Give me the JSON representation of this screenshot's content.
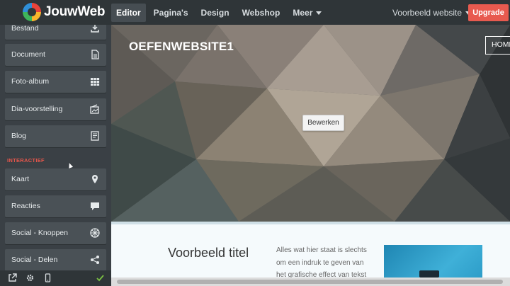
{
  "app": {
    "brand": "JouwWeb"
  },
  "nav": {
    "items": [
      {
        "label": "Editor"
      },
      {
        "label": "Pagina's"
      },
      {
        "label": "Design"
      },
      {
        "label": "Webshop"
      },
      {
        "label": "Meer"
      }
    ],
    "site_selector": "Voorbeeld website",
    "upgrade": "Upgrade"
  },
  "sidebar": {
    "items": [
      {
        "label": "Bestand",
        "icon": "download-icon"
      },
      {
        "label": "Document",
        "icon": "document-icon"
      },
      {
        "label": "Foto-album",
        "icon": "grid-icon"
      },
      {
        "label": "Dia-voorstelling",
        "icon": "slideshow-icon"
      },
      {
        "label": "Blog",
        "icon": "blog-icon"
      },
      {
        "label": "Kaart",
        "icon": "map-pin-icon"
      },
      {
        "label": "Reacties",
        "icon": "comment-icon"
      },
      {
        "label": "Social - Knoppen",
        "icon": "social-buttons-icon"
      },
      {
        "label": "Social - Delen",
        "icon": "share-icon"
      }
    ],
    "section_heading": "INTERACTIEF"
  },
  "canvas": {
    "site_title": "OEFENWEBSITE1",
    "home_button": "HOME",
    "edit_button": "Bewerken",
    "content_title": "Voorbeeld titel",
    "content_text": "Alles wat hier staat is slechts om een indruk te geven van het grafische effect van tekst"
  },
  "colors": {
    "topbar": "#2f3538",
    "sidebar": "#3a4045",
    "accent_upgrade": "#e85a4f",
    "section_heading": "#e8564b"
  }
}
